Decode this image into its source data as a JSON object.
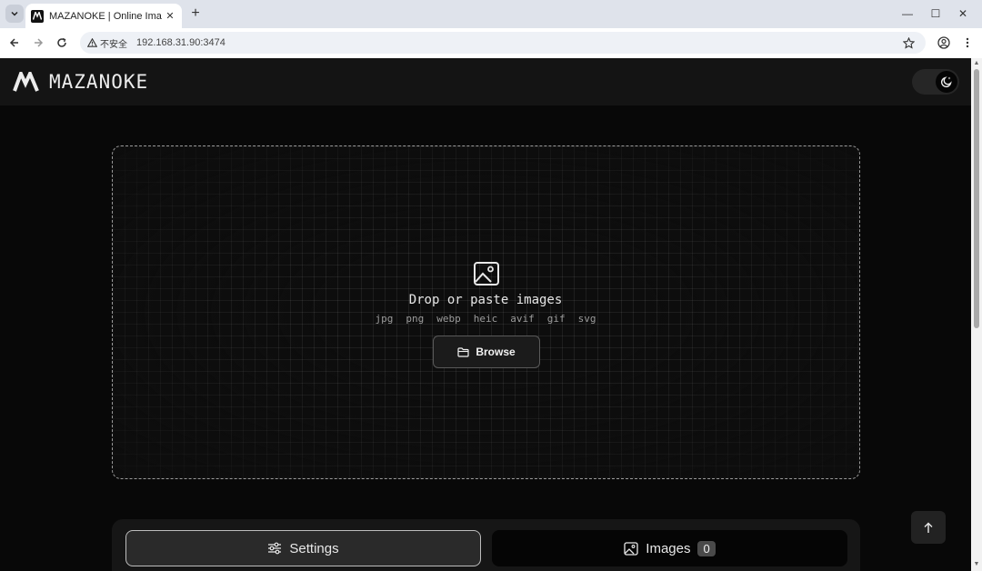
{
  "browser": {
    "tab_title": "MAZANOKE | Online Image Converter",
    "security_label": "不安全",
    "url": "192.168.31.90:3474"
  },
  "app": {
    "logo_text": "MAZANOKE",
    "dropzone": {
      "title": "Drop or paste images",
      "formats": [
        "jpg",
        "png",
        "webp",
        "heic",
        "avif",
        "gif",
        "svg"
      ],
      "browse_label": "Browse"
    },
    "settings_label": "Settings",
    "images_label": "Images",
    "images_count": "0"
  }
}
